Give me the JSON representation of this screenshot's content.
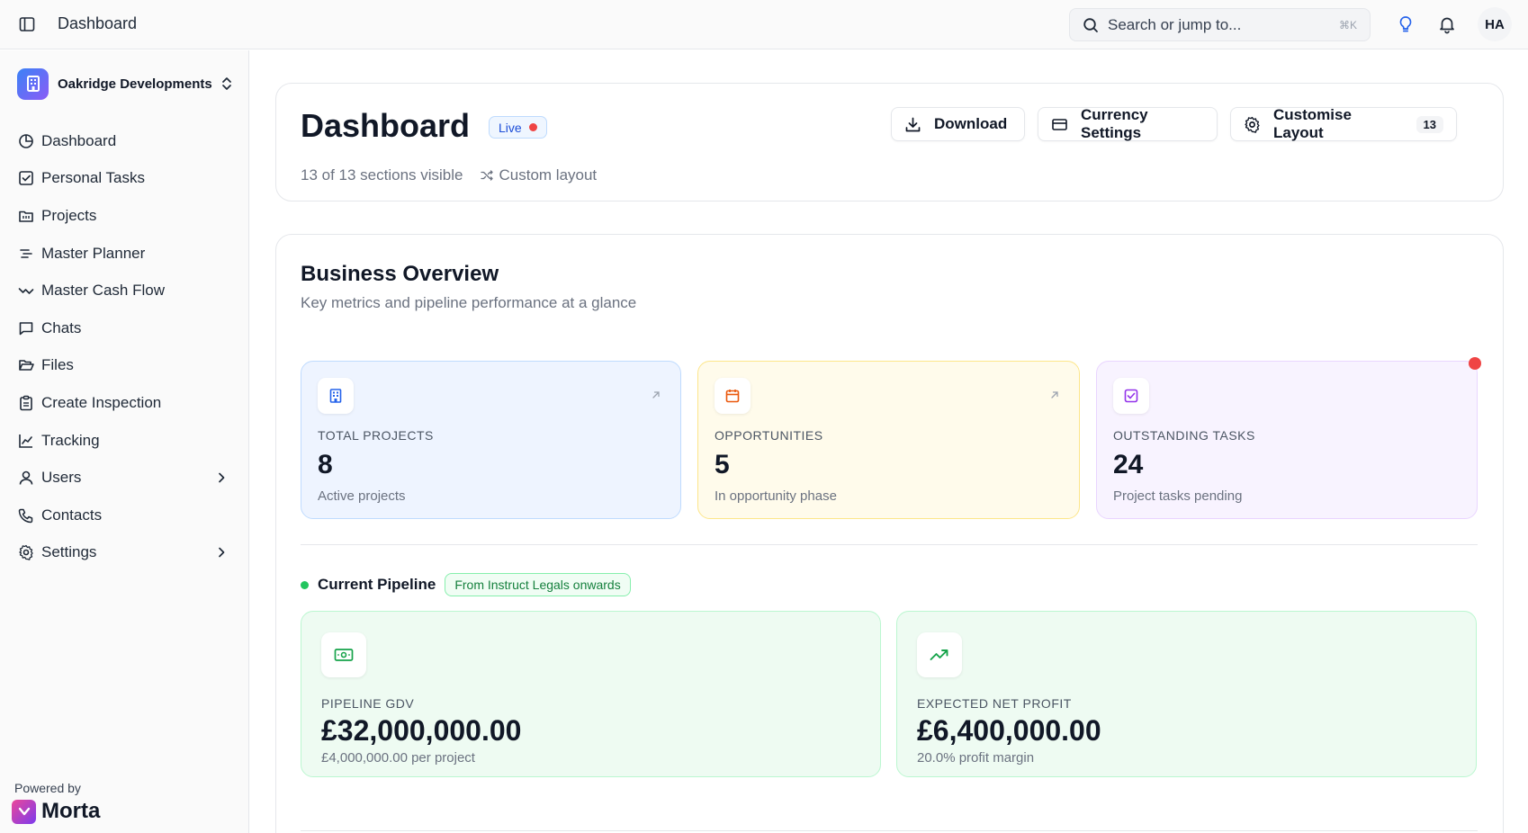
{
  "topbar": {
    "title": "Dashboard",
    "search_placeholder": "Search or jump to...",
    "search_shortcut": "⌘K",
    "avatar_initials": "HA"
  },
  "sidebar": {
    "org_name": "Oakridge Developments",
    "items": [
      {
        "label": "Dashboard",
        "icon": "pie-chart-icon",
        "has_chevron": false
      },
      {
        "label": "Personal Tasks",
        "icon": "checkbox-icon",
        "has_chevron": false
      },
      {
        "label": "Projects",
        "icon": "folder-icon",
        "has_chevron": false
      },
      {
        "label": "Master Planner",
        "icon": "planner-icon",
        "has_chevron": false
      },
      {
        "label": "Master Cash Flow",
        "icon": "trend-icon",
        "has_chevron": false
      },
      {
        "label": "Chats",
        "icon": "chat-icon",
        "has_chevron": false
      },
      {
        "label": "Files",
        "icon": "folder-open-icon",
        "has_chevron": false
      },
      {
        "label": "Create Inspection",
        "icon": "clipboard-icon",
        "has_chevron": false
      },
      {
        "label": "Tracking",
        "icon": "chart-icon",
        "has_chevron": false
      },
      {
        "label": "Users",
        "icon": "user-icon",
        "has_chevron": true
      },
      {
        "label": "Contacts",
        "icon": "phone-icon",
        "has_chevron": false
      },
      {
        "label": "Settings",
        "icon": "gear-icon",
        "has_chevron": true
      }
    ],
    "powered_by": "Powered by",
    "brand": "Morta"
  },
  "header": {
    "title": "Dashboard",
    "live_label": "Live",
    "sections_visible": "13 of 13 sections visible",
    "layout_label": "Custom layout",
    "download_label": "Download",
    "currency_label": "Currency Settings",
    "customise_label": "Customise Layout",
    "customise_count": "13"
  },
  "overview": {
    "title": "Business Overview",
    "subtitle": "Key metrics and pipeline performance at a glance",
    "stats": [
      {
        "label": "Total Projects",
        "value": "8",
        "desc": "Active projects"
      },
      {
        "label": "Opportunities",
        "value": "5",
        "desc": "In opportunity phase"
      },
      {
        "label": "Outstanding Tasks",
        "value": "24",
        "desc": "Project tasks pending"
      }
    ],
    "pipeline": {
      "title": "Current Pipeline",
      "tag": "From Instruct Legals onwards",
      "gdv_label": "Pipeline GDV",
      "gdv_value": "£32,000,000.00",
      "gdv_desc": "£4,000,000.00 per project",
      "profit_label": "Expected Net Profit",
      "profit_value": "£6,400,000.00",
      "profit_desc": "20.0% profit margin"
    }
  },
  "colors": {
    "accent_blue": "#2563eb",
    "live_red": "#ef4444",
    "pipeline_green": "#22c55e"
  }
}
